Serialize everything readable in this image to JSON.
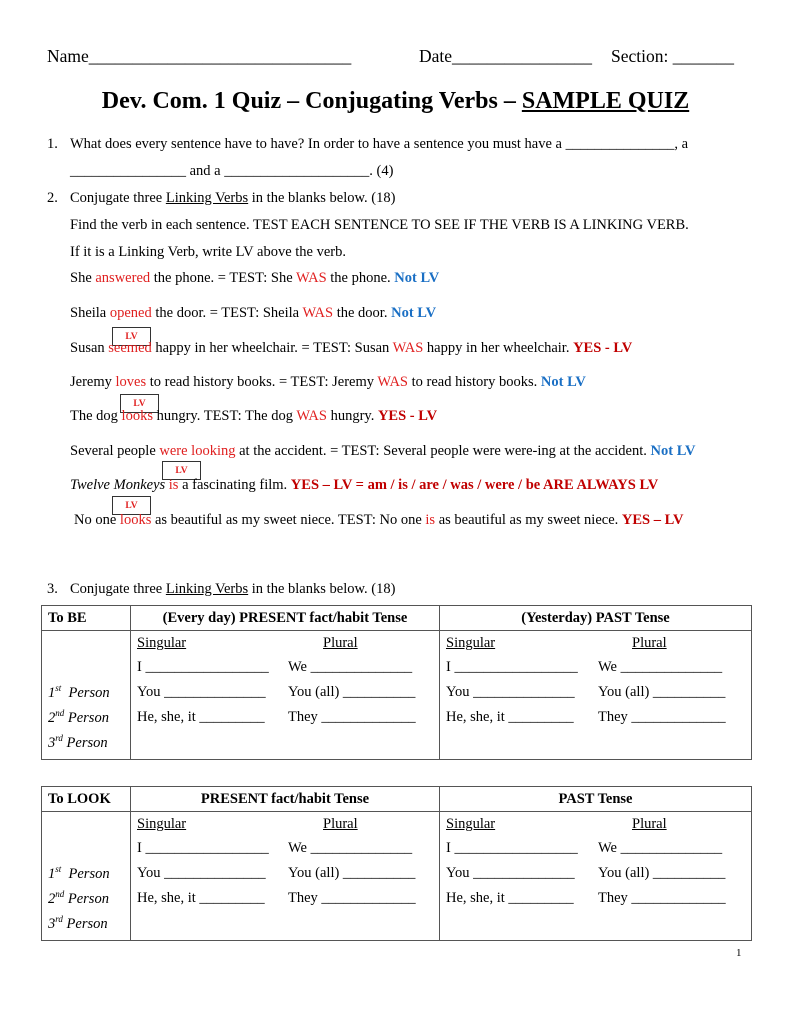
{
  "header": {
    "name_label": "Name______________________________",
    "date_label": "Date________________",
    "section_label": "Section: _______"
  },
  "title": {
    "prefix": "Dev. Com. 1 Quiz – Conjugating Verbs – ",
    "underlined": "SAMPLE QUIZ"
  },
  "q1": {
    "number": "1.",
    "line1": "What does every sentence have to have?  In order to have a sentence you must have a _______________, a",
    "line2": "________________  and a  ____________________. (4)"
  },
  "q2": {
    "number": "2.",
    "prefix": "Conjugate three ",
    "link": "Linking Verbs",
    "suffix": " in the blanks below. (18)",
    "instr1": "Find the verb in each sentence. TEST EACH SENTENCE TO SEE IF THE VERB IS A LINKING VERB.",
    "instr2": "If it is a Linking Verb, write LV above the verb.",
    "lv_label": "LV",
    "sentences": [
      {
        "a": "She ",
        "verb": "answered",
        "b": " the phone.  =   TEST: She ",
        "test": "WAS",
        "c": " the phone.  ",
        "result": "Not LV"
      },
      {
        "a": "Sheila ",
        "verb": "opened",
        "b": " the door.  =   TEST: Sheila ",
        "test": "WAS",
        "c": " the door.  ",
        "result": "Not LV"
      },
      {
        "a": "Susan ",
        "verb": "seemed",
        "b": " happy in her wheelchair.   =   TEST: Susan ",
        "test": "WAS",
        "c": " happy in her wheelchair. ",
        "result": "YES - LV"
      },
      {
        "a": "Jeremy ",
        "verb": "loves",
        "b": " to read history books.   =   TEST: Jeremy ",
        "test": "WAS",
        "c": " to read history books. ",
        "result": "Not LV"
      },
      {
        "a": "The dog ",
        "verb": "looks",
        "b": " hungry.  TEST: The dog ",
        "test": "WAS",
        "c": " hungry.   ",
        "result": "YES - LV"
      },
      {
        "a": "Several people ",
        "verb": "were looking",
        "b": " at the accident. = TEST: Several people were were-ing at the accident. ",
        "test": "",
        "c": "",
        "result": "Not LV"
      },
      {
        "a_italic": "Twelve Monkeys",
        "a": " ",
        "verb": "is",
        "b": " a fascinating film. ",
        "test": "",
        "c": "",
        "result": "YES – LV = am / is / are / was / were / be  ARE ALWAYS LV"
      },
      {
        "a": "No one ",
        "verb": "looks",
        "b": " as beautiful as my sweet niece. TEST: No one ",
        "test": "is",
        "c": " as beautiful as my sweet niece.  ",
        "result": "YES – LV"
      }
    ]
  },
  "q3": {
    "number": "3.",
    "prefix": "Conjugate three ",
    "link": "Linking Verbs",
    "suffix": " in the blanks below. (18)"
  },
  "tables": [
    {
      "verb": "To BE",
      "present_header": "(Every day) PRESENT fact/habit Tense",
      "past_header": "(Yesterday) PAST Tense",
      "singular": "Singular",
      "plural": "Plural",
      "persons": [
        {
          "num": "1",
          "sup": "st",
          "label": "  Person"
        },
        {
          "num": "2",
          "sup": "nd",
          "label": " Person"
        },
        {
          "num": "3",
          "sup": "rd",
          "label": " Person"
        }
      ],
      "singular_rows": [
        "I _________________",
        "You ______________",
        "He, she, it _________"
      ],
      "plural_rows": [
        "We ______________",
        "You (all) __________",
        "They _____________"
      ]
    },
    {
      "verb": "To LOOK",
      "present_header": "PRESENT fact/habit Tense",
      "past_header": "PAST Tense",
      "singular": "Singular",
      "plural": "Plural",
      "persons": [
        {
          "num": "1",
          "sup": "st",
          "label": "  Person"
        },
        {
          "num": "2",
          "sup": "nd",
          "label": " Person"
        },
        {
          "num": "3",
          "sup": "rd",
          "label": " Person"
        }
      ],
      "singular_rows": [
        "I _________________",
        "You ______________",
        "He, she, it _________"
      ],
      "plural_rows": [
        "We ______________",
        "You (all) __________",
        "They _____________"
      ]
    }
  ],
  "page_number": "1"
}
